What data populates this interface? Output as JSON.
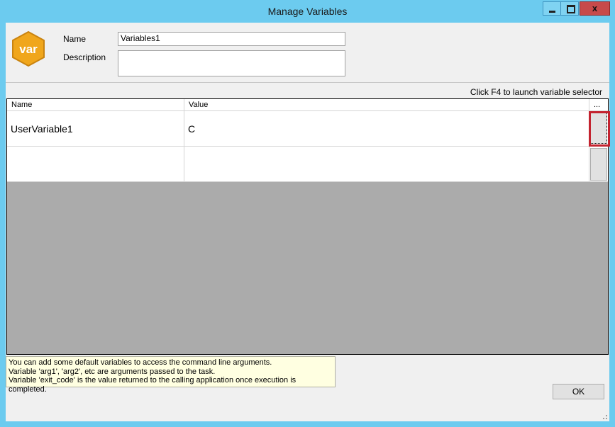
{
  "window": {
    "title": "Manage Variables"
  },
  "titlebar_buttons": {
    "minimize": "minimize-icon",
    "maximize": "maximize-icon",
    "close": "x"
  },
  "logo": {
    "text": "var",
    "color": "#f0a61b"
  },
  "form": {
    "name_label": "Name",
    "name_value": "Variables1",
    "description_label": "Description",
    "description_value": ""
  },
  "hint": "Click F4 to launch variable selector",
  "grid": {
    "columns": [
      "Name",
      "Value",
      "..."
    ],
    "rows": [
      {
        "name": "UserVariable1",
        "value": "C"
      },
      {
        "name": "",
        "value": ""
      }
    ]
  },
  "info": {
    "lines": [
      "You can add some default variables to access the command line arguments.",
      "Variable 'arg1', 'arg2', etc are arguments passed to the task.",
      "Variable 'exit_code' is the value returned to the calling application once execution is completed."
    ]
  },
  "buttons": {
    "ok": "OK"
  },
  "colors": {
    "titlebar": "#6ccbef",
    "highlight": "#c3232f",
    "grid_background": "#ababab",
    "info_background": "#ffffe1"
  }
}
